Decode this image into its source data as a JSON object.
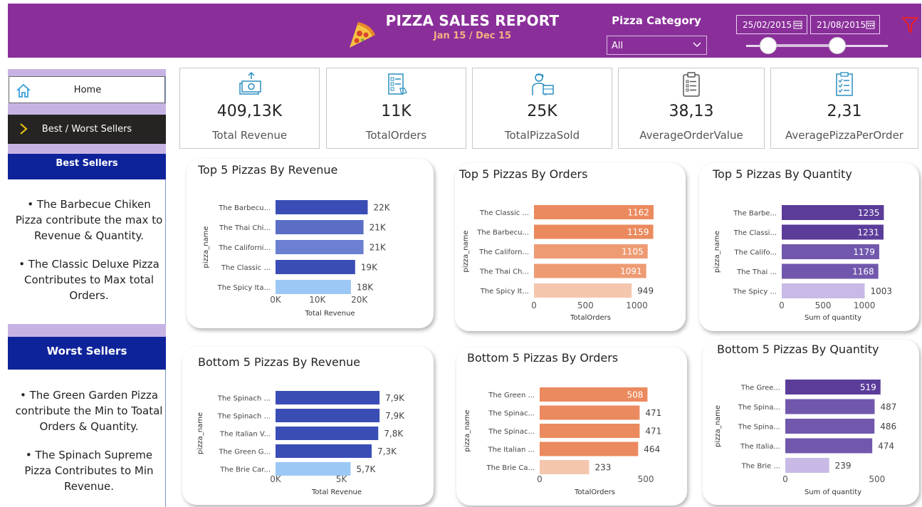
{
  "header": {
    "title": "PIZZA SALES REPORT",
    "subtitle": "Jan 15 / Dec 15",
    "category_label": "Pizza Category",
    "category_value": "All",
    "date_from": "25/02/2015",
    "date_to": "21/08/2015",
    "colors": {
      "background": "#8a2f9a",
      "subtitle": "#f4b183",
      "filter": "#e8202a"
    }
  },
  "sidebar": {
    "home_label": "Home",
    "best_worst_label": "Best / Worst Sellers",
    "best_title": "Best Sellers",
    "best_notes": [
      "• The Barbecue Chiken Pizza contribute the max to Revenue & Quantity.",
      "• The Classic Deluxe Pizza Contributes to Max total Orders."
    ],
    "worst_title": "Worst Sellers",
    "worst_notes": [
      "• The Green Garden Pizza contribute the Min to Toatal Orders & Quantity.",
      "• The Spinach Supreme Pizza Contributes to Min Revenue."
    ]
  },
  "kpis": [
    {
      "value": "409,13K",
      "label": "Total Revenue",
      "icon": "money-icon"
    },
    {
      "value": "11K",
      "label": "TotalOrders",
      "icon": "order-list-icon"
    },
    {
      "value": "25K",
      "label": "TotalPizzaSold",
      "icon": "delivery-icon"
    },
    {
      "value": "38,13",
      "label": "AverageOrderValue",
      "icon": "clipboard-icon"
    },
    {
      "value": "2,31",
      "label": "AveragePizzaPerOrder",
      "icon": "checklist-icon"
    }
  ],
  "chart_data": [
    {
      "id": "top-revenue",
      "type": "bar",
      "orientation": "horizontal",
      "title": "Top 5 Pizzas By Revenue",
      "xlabel": "Total Revenue",
      "ylabel": "pizza_name",
      "categories": [
        "The Barbecu...",
        "The Thai Chi...",
        "The Californi...",
        "The Classic ...",
        "The Spicy Ita..."
      ],
      "values": [
        22000,
        21000,
        21000,
        19000,
        18000
      ],
      "value_labels": [
        "22K",
        "21K",
        "21K",
        "19K",
        "18K"
      ],
      "xlim": [
        0,
        26000
      ],
      "ticks": [
        0,
        10000,
        20000
      ],
      "tick_labels": [
        "0K",
        "10K",
        "20K"
      ],
      "colors": [
        "#3a4db5",
        "#5a6ec6",
        "#6b80d2",
        "#3a4db5",
        "#9cc8f5"
      ],
      "label_inside": false
    },
    {
      "id": "top-orders",
      "type": "bar",
      "orientation": "horizontal",
      "title": "Top 5 Pizzas By Orders",
      "xlabel": "TotalOrders",
      "ylabel": "pizza_name",
      "categories": [
        "The Classic ...",
        "The Barbecu...",
        "The Californ...",
        "The Thai Ch...",
        "The Spicy It..."
      ],
      "values": [
        1162,
        1159,
        1105,
        1091,
        949
      ],
      "value_labels": [
        "1162",
        "1159",
        "1105",
        "1091",
        "949"
      ],
      "xlim": [
        0,
        1100
      ],
      "ticks": [
        0,
        500,
        1000
      ],
      "tick_labels": [
        "0",
        "500",
        "1000"
      ],
      "colors": [
        "#eb8a5e",
        "#eb8a5e",
        "#ee9b73",
        "#ee9b73",
        "#f4c6ae"
      ],
      "label_inside": true
    },
    {
      "id": "top-quantity",
      "type": "bar",
      "orientation": "horizontal",
      "title": "Top 5 Pizzas By Quantity",
      "xlabel": "Sum of quantity",
      "ylabel": "pizza_name",
      "categories": [
        "The Barbe...",
        "The Classi...",
        "The Califo...",
        "The Thai ...",
        "The Spicy ..."
      ],
      "values": [
        1235,
        1231,
        1179,
        1168,
        1003
      ],
      "value_labels": [
        "1235",
        "1231",
        "1179",
        "1168",
        "1003"
      ],
      "xlim": [
        0,
        1240
      ],
      "ticks": [
        0,
        500,
        1000
      ],
      "tick_labels": [
        "0",
        "500",
        "1000"
      ],
      "colors": [
        "#5b3c99",
        "#5b3c99",
        "#7158ad",
        "#7158ad",
        "#c8b9e6"
      ],
      "label_inside": true
    },
    {
      "id": "bottom-revenue",
      "type": "bar",
      "orientation": "horizontal",
      "title": "Bottom 5 Pizzas By Revenue",
      "xlabel": "Total Revenue",
      "ylabel": "pizza_name",
      "categories": [
        "The Spinach ...",
        "The Spinach ...",
        "The Italian V...",
        "The Green G...",
        "The Brie Car..."
      ],
      "values": [
        7900,
        7900,
        7800,
        7300,
        5700
      ],
      "value_labels": [
        "7,9K",
        "7,9K",
        "7,8K",
        "7,3K",
        "5,7K"
      ],
      "xlim": [
        0,
        9300
      ],
      "ticks": [
        0,
        5000
      ],
      "tick_labels": [
        "0K",
        "5K"
      ],
      "colors": [
        "#3a4db5",
        "#3a4db5",
        "#3a4db5",
        "#3a4db5",
        "#9cc8f5"
      ],
      "label_inside": false
    },
    {
      "id": "bottom-orders",
      "type": "bar",
      "orientation": "horizontal",
      "title": "Bottom 5 Pizzas By Orders",
      "xlabel": "TotalOrders",
      "ylabel": "pizza_name",
      "categories": [
        "The Green ...",
        "The Spinac...",
        "The Spinac...",
        "The Italian ...",
        "The Brie Ca..."
      ],
      "values": [
        508,
        471,
        471,
        464,
        233
      ],
      "value_labels": [
        "508",
        "471",
        "471",
        "464",
        "233"
      ],
      "xlim": [
        0,
        520
      ],
      "ticks": [
        0,
        500
      ],
      "tick_labels": [
        "0",
        "500"
      ],
      "colors": [
        "#eb8a5e",
        "#eb8a5e",
        "#eb8a5e",
        "#eb8a5e",
        "#f4c6ae"
      ],
      "label_inside": true,
      "inside_first_only": true
    },
    {
      "id": "bottom-quantity",
      "type": "bar",
      "orientation": "horizontal",
      "title": "Bottom 5 Pizzas By Quantity",
      "xlabel": "Sum of quantity",
      "ylabel": "pizza_name",
      "categories": [
        "The Gree...",
        "The Spina...",
        "The Spina...",
        "The Italia...",
        "The Brie ..."
      ],
      "values": [
        519,
        487,
        486,
        474,
        239
      ],
      "value_labels": [
        "519",
        "487",
        "486",
        "474",
        "239"
      ],
      "xlim": [
        0,
        520
      ],
      "ticks": [
        0,
        500
      ],
      "tick_labels": [
        "0",
        "500"
      ],
      "colors": [
        "#5b3c99",
        "#7158ad",
        "#7158ad",
        "#7158ad",
        "#c8b9e6"
      ],
      "label_inside": true,
      "inside_first_only": true
    }
  ]
}
